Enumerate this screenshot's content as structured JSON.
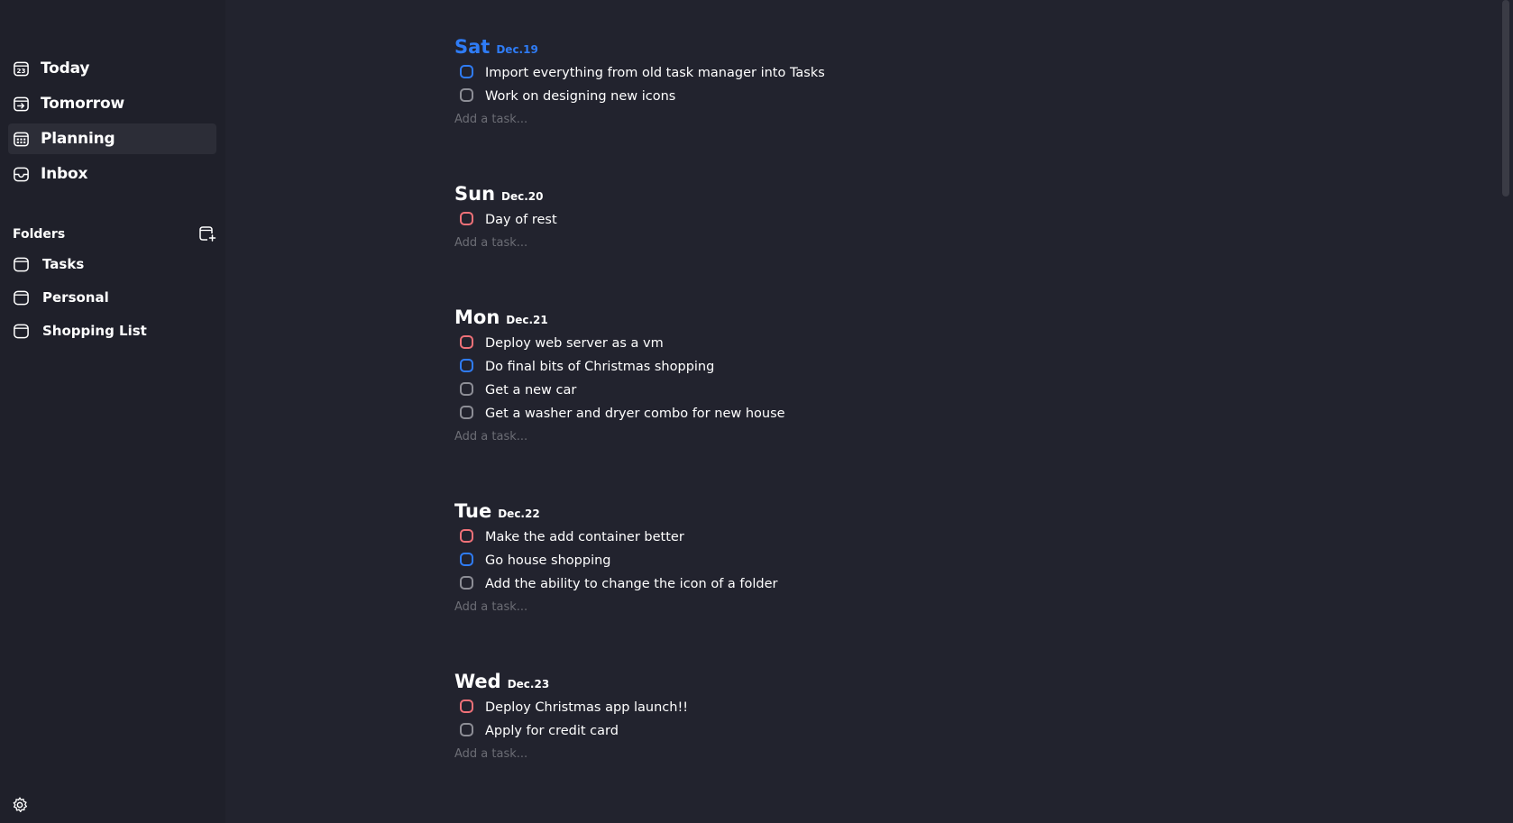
{
  "sidebar": {
    "nav": [
      {
        "label": "Today",
        "icon": "calendar-today-icon",
        "active": false
      },
      {
        "label": "Tomorrow",
        "icon": "calendar-arrow-icon",
        "active": false
      },
      {
        "label": "Planning",
        "icon": "calendar-grid-icon",
        "active": true
      },
      {
        "label": "Inbox",
        "icon": "inbox-icon",
        "active": false
      }
    ],
    "today_icon_number": "23",
    "folders_title": "Folders",
    "folders": [
      {
        "label": "Tasks",
        "icon": "folder-icon"
      },
      {
        "label": "Personal",
        "icon": "folder-icon"
      },
      {
        "label": "Shopping List",
        "icon": "folder-icon"
      }
    ],
    "add_folder_icon": "add-folder-icon",
    "settings_icon": "gear-icon"
  },
  "colors": {
    "accent": "#2f7cf6",
    "priority_high": "#f07178",
    "priority_normal": "#2f7cf6",
    "priority_none": "#8d8e96",
    "background": "#22232e",
    "sidebar_background": "#1f202a"
  },
  "add_task_placeholder": "Add a task...",
  "days": [
    {
      "name": "Sat",
      "date": "Dec.19",
      "is_today": true,
      "tasks": [
        {
          "text": "Import everything from old task manager into Tasks",
          "priority": "blue"
        },
        {
          "text": "Work on designing new icons",
          "priority": "gray"
        }
      ]
    },
    {
      "name": "Sun",
      "date": "Dec.20",
      "is_today": false,
      "tasks": [
        {
          "text": "Day of rest",
          "priority": "red"
        }
      ]
    },
    {
      "name": "Mon",
      "date": "Dec.21",
      "is_today": false,
      "tasks": [
        {
          "text": "Deploy web server as a vm",
          "priority": "red"
        },
        {
          "text": "Do final bits of Christmas shopping",
          "priority": "blue"
        },
        {
          "text": "Get a new car",
          "priority": "gray"
        },
        {
          "text": "Get a washer and dryer combo for new house",
          "priority": "gray"
        }
      ]
    },
    {
      "name": "Tue",
      "date": "Dec.22",
      "is_today": false,
      "tasks": [
        {
          "text": "Make the add container better",
          "priority": "red"
        },
        {
          "text": "Go house shopping",
          "priority": "blue"
        },
        {
          "text": "Add the ability to change the icon of a folder",
          "priority": "gray"
        }
      ]
    },
    {
      "name": "Wed",
      "date": "Dec.23",
      "is_today": false,
      "tasks": [
        {
          "text": "Deploy Christmas app launch!!",
          "priority": "red"
        },
        {
          "text": "Apply for credit card",
          "priority": "gray"
        }
      ]
    }
  ]
}
